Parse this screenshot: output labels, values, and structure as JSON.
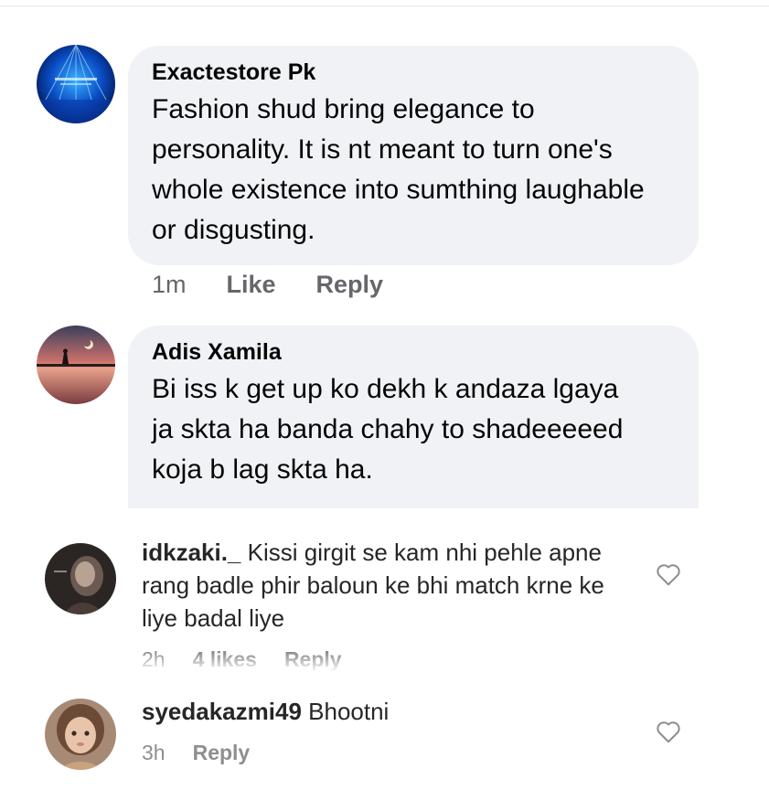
{
  "fb_comments": [
    {
      "name": "Exactestore Pk",
      "text": "Fashion shud bring elegance to personality. It is nt meant to turn one's whole existence into sumthing laughable or disgusting.",
      "time": "1m",
      "like_label": "Like",
      "reply_label": "Reply"
    },
    {
      "name": "Adis Xamila",
      "text": "Bi iss k get up ko dekh k andaza lgaya ja skta ha banda chahy to shadeeeeed koja b lag skta ha."
    }
  ],
  "ig_comments": [
    {
      "username": "idkzaki._",
      "text": "Kissi girgit se kam nhi pehle apne rang badle phir baloun ke bhi match krne ke liye badal liye",
      "time": "2h",
      "likes": "4 likes",
      "reply_label": "Reply"
    },
    {
      "username": "syedakazmi49",
      "text": "Bhootni",
      "time": "3h",
      "reply_label": "Reply"
    }
  ],
  "icons": {
    "like": "heart-outline-icon"
  },
  "colors": {
    "bubble": "#f0f2f5",
    "fb_meta": "#65676b",
    "ig_meta": "#8e8e8e"
  }
}
